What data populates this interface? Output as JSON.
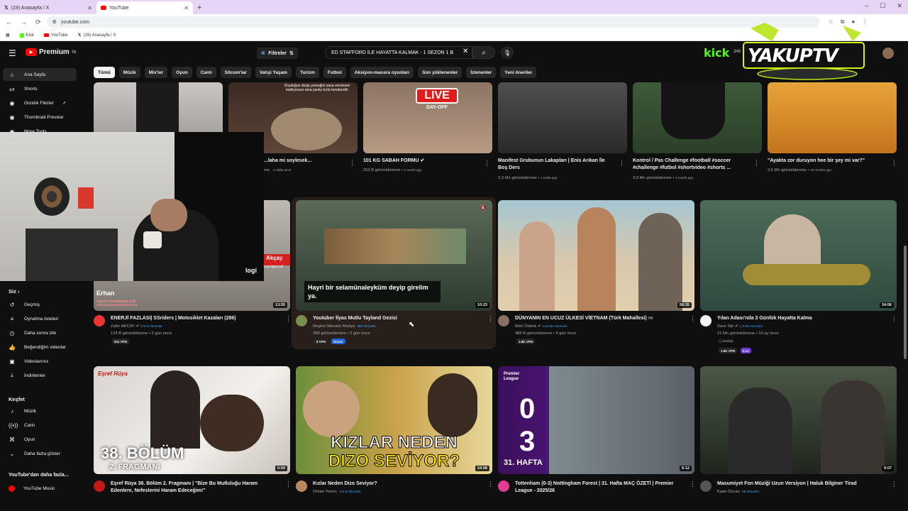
{
  "browser": {
    "tabs": [
      {
        "label": "(19) Anasayfa / X",
        "active": false,
        "icon": "x-logo-icon"
      },
      {
        "label": "YouTube",
        "active": true,
        "icon": "youtube-logo-icon"
      }
    ],
    "url": "youtube.com",
    "bookmarks": [
      {
        "label": "Kick",
        "icon": "kick-icon"
      },
      {
        "label": "YouTube",
        "icon": "youtube-logo-icon"
      },
      {
        "label": "(19) Anasayfa / X",
        "icon": "x-logo-icon"
      }
    ]
  },
  "header": {
    "logo": "Premium",
    "logo_sup": "TR",
    "filters_label": "Filtreler",
    "search_value": "ED STAFFORD İLE HAYATTA KALMAK - 1 SEZON 1 B",
    "overlay_kick": "kick",
    "overlay_views": "348",
    "overlay_brand": "YAKUPTV"
  },
  "chips": [
    "Tümü",
    "Müzik",
    "Mix'ler",
    "Oyun",
    "Canlı",
    "Sitcom'lar",
    "Vahşi Yaşam",
    "Turizm",
    "Futbol",
    "Aksiyon-macera oyunları",
    "Son yüklenenler",
    "İzlenenler",
    "Yeni öneriler"
  ],
  "sidebar": {
    "top": [
      {
        "label": "Ana Sayfa",
        "icon": "home-icon",
        "active": true
      },
      {
        "label": "Shorts",
        "icon": "shorts-icon"
      },
      {
        "label": "Günlük Fikirler",
        "icon": "channel-icon"
      },
      {
        "label": "Thumbnail Preview",
        "icon": "channel-icon"
      },
      {
        "label": "More Tools",
        "icon": "channel-icon"
      }
    ],
    "you_label": "Siz",
    "you": [
      {
        "label": "Geçmiş",
        "icon": "history-icon"
      },
      {
        "label": "Oynatma listeleri",
        "icon": "playlist-icon"
      },
      {
        "label": "Daha sonra izle",
        "icon": "clock-icon"
      },
      {
        "label": "Beğendiğim videolar",
        "icon": "thumbs-up-icon"
      },
      {
        "label": "Videolarınız",
        "icon": "video-icon"
      },
      {
        "label": "İndirilenler",
        "icon": "download-icon"
      }
    ],
    "explore_label": "Keşfet",
    "explore": [
      {
        "label": "Müzik",
        "icon": "music-icon"
      },
      {
        "label": "Canlı",
        "icon": "live-icon"
      },
      {
        "label": "Oyun",
        "icon": "gamepad-icon"
      },
      {
        "label": "Daha fazla göster",
        "icon": "chevron-down-icon"
      }
    ],
    "more_label": "YouTube'dan daha fazla...",
    "more": [
      {
        "label": "YouTube Music",
        "icon": "youtube-music-icon"
      }
    ]
  },
  "row1": [
    {
      "title": "...laha mi soylesek...",
      "meta": "4 Hafta önce",
      "thumb_text": "Doyduğun deyip yemeğini sana vermesini bekliyorsun ama yanlış kızla beraberdin",
      "prefix": "me"
    },
    {
      "title": "101 KG SABAH FORMU ✔",
      "views": "252 B görüntülenme",
      "age": "1 month ago",
      "thumb_text": "LIVE",
      "thumb_sub": "DAY-OFF"
    },
    {
      "title": "Manifest Grubunun Lakapları | Enis Arıkan İle Boş Ders",
      "views": "3,3 Mn görüntülenme",
      "age": "1 Hafta ago"
    },
    {
      "title": "Kontrol / Pas Challenge  #football #soccer #challenge #futbol #shortvideo #shorts ...",
      "views": "3,9 Mn görüntülenme",
      "age": "1 month ago"
    },
    {
      "title": "\"Ayakta zor duruyon hee bir şey mi var?\"",
      "views": "3,5 Mn görüntülenme",
      "age": "10 months ago"
    }
  ],
  "row2": [
    {
      "title": "ENERJİ FAZLASI| SSriders | Motosiklet Kazaları (286)",
      "channel": "Zafer AKCAY",
      "subs": "376 B Aboneler",
      "stats": "124 B görüntülenme • 2 gün önce",
      "vph": "631 VPH",
      "duration": "13:55",
      "thumb_overlay": "Erhan",
      "thumb_sub": "VİDEO GÖNDERMEK İÇİN zaferakcay.wetransfer.com",
      "thumb_tag": "Akçay",
      "thumb_tag2": "Kay Eğlenceli"
    },
    {
      "title": "Youtuber İlyas Mutlu Tayland Gezisi",
      "channel": "Beşinci Mevsim Medya",
      "subs": "550 Aboneler",
      "stats": "358 görüntülenme • 2 gün önce",
      "vph": "9 VPH",
      "remix": "Remix",
      "duration": "10:23",
      "caption": "Hayri bir selamünaleyküm deyip girelim ya."
    },
    {
      "title": "DÜNYANIN EN UCUZ ÜLKESİ VİETNAM (Türk Mahallesi)",
      "title_suffix": "VN",
      "channel": "Mert Öztürk",
      "subs": "1,54 Mn Aboneler",
      "stats": "485 B görüntülenme • 4 gün önce",
      "vph": "1.8K VPH",
      "duration": "58:35"
    },
    {
      "title": "Yılan Adası'nda 3 Günlük Hayatta Kalma",
      "channel": "Dara Tah",
      "subs": "1,3 Mn Aboneler",
      "stats": "21 Mn görüntülenme • 10 ay önce",
      "dub": "Dublajlı",
      "vph": "1.6K VPH",
      "mult": "8.1x",
      "duration": "34:06"
    }
  ],
  "row3": [
    {
      "title": "Eşref Rüya 38. Bölüm 2. Fragmanı | \"Bize Bu Mutluluğu Haram Edenlere, Nefeslerini Haram Edeceğim!\"",
      "channel": "",
      "duration": "0:59",
      "big1": "38. BÖLÜM",
      "big2": "2. FRAGMANI",
      "brand": "Eşref Rüya"
    },
    {
      "title": "Kızlar Neden Dizo Seviyor?",
      "channel": "Orhan Yenen",
      "subs": "121 B Aboneler",
      "duration": "24:08",
      "big1": "KIZLAR NEDEN",
      "big2": "DIZO SEVİYOR?"
    },
    {
      "title": "Tottenham (0-3) Nottingham Forest | 31. Hafta MAÇ ÖZETİ | Premier League - 2025/26",
      "channel": "",
      "duration": "6:12",
      "big1": "0",
      "big2": "3",
      "big3": "31. HAFTA",
      "league": "Premier League"
    },
    {
      "title": "Masumiyet Fon Müziği Uzun Versiyon | Haluk Bilginer Tirad",
      "channel": "Kaan Özcan",
      "subs": "58 Aboneler",
      "duration": "9:07"
    }
  ],
  "webcam": {
    "brand": "logi"
  }
}
